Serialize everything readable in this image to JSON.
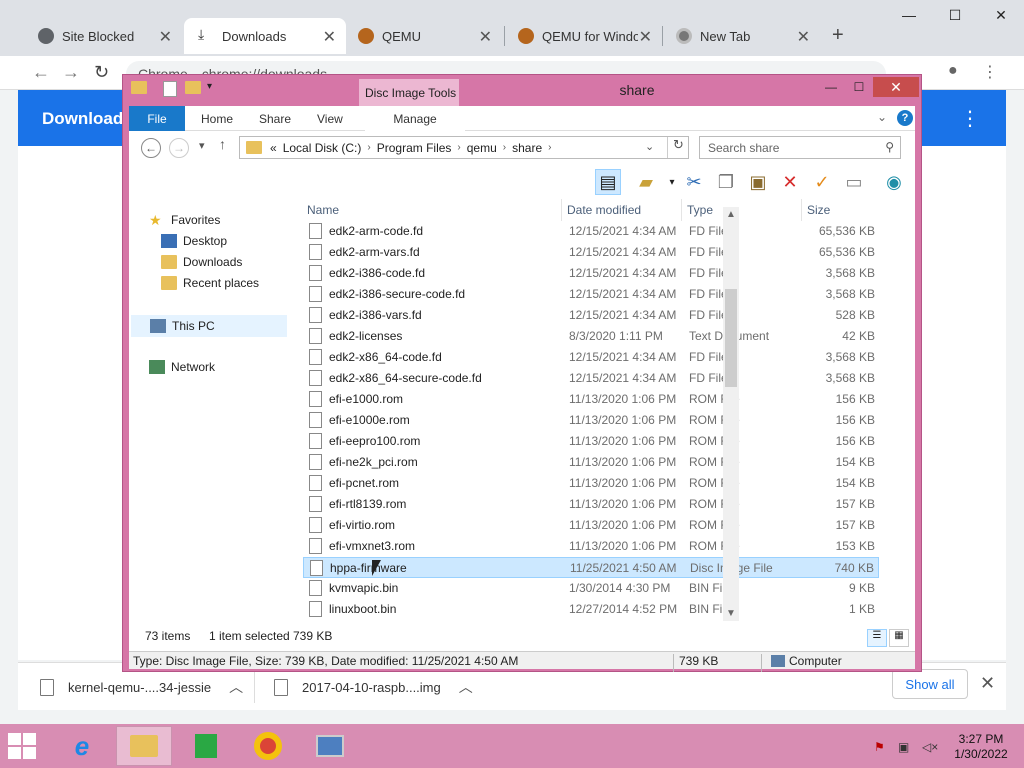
{
  "browser": {
    "tabs": [
      {
        "label": "Site Blocked",
        "icon": "globe-icon"
      },
      {
        "label": "Downloads",
        "icon": "download-icon"
      },
      {
        "label": "QEMU",
        "icon": "qemu-icon"
      },
      {
        "label": "QEMU for Windo",
        "icon": "qemu-icon"
      },
      {
        "label": "New Tab",
        "icon": "chrome-icon"
      }
    ],
    "new_tab": "+",
    "window_controls": {
      "minimize": "—",
      "maximize": "☐",
      "close": "✕"
    },
    "omnibox": {
      "site": "Chrome",
      "url": "chrome://downloads"
    },
    "page_title": "Downloads",
    "download_items": [
      {
        "name": "kernel-qemu-....34-jessie"
      },
      {
        "name": "2017-04-10-raspb....img"
      }
    ],
    "show_all": "Show all"
  },
  "explorer": {
    "title": "share",
    "contextual_tab_group": "Disc Image Tools",
    "ribbon_tabs": [
      "File",
      "Home",
      "Share",
      "View",
      "Manage"
    ],
    "address": {
      "prefix": "«",
      "crumbs": [
        "Local Disk (C:)",
        "Program Files",
        "qemu",
        "share"
      ]
    },
    "search_placeholder": "Search share",
    "nav_pane": {
      "favorites": "Favorites",
      "desktop": "Desktop",
      "downloads": "Downloads",
      "recent": "Recent places",
      "this_pc": "This PC",
      "network": "Network"
    },
    "columns": {
      "name": "Name",
      "date": "Date modified",
      "type": "Type",
      "size": "Size"
    },
    "files": [
      {
        "name": "edk2-arm-code.fd",
        "date": "12/15/2021 4:34 AM",
        "type": "FD File",
        "size": "65,536 KB"
      },
      {
        "name": "edk2-arm-vars.fd",
        "date": "12/15/2021 4:34 AM",
        "type": "FD File",
        "size": "65,536 KB"
      },
      {
        "name": "edk2-i386-code.fd",
        "date": "12/15/2021 4:34 AM",
        "type": "FD File",
        "size": "3,568 KB"
      },
      {
        "name": "edk2-i386-secure-code.fd",
        "date": "12/15/2021 4:34 AM",
        "type": "FD File",
        "size": "3,568 KB"
      },
      {
        "name": "edk2-i386-vars.fd",
        "date": "12/15/2021 4:34 AM",
        "type": "FD File",
        "size": "528 KB"
      },
      {
        "name": "edk2-licenses",
        "date": "8/3/2020 1:11 PM",
        "type": "Text Document",
        "size": "42 KB"
      },
      {
        "name": "edk2-x86_64-code.fd",
        "date": "12/15/2021 4:34 AM",
        "type": "FD File",
        "size": "3,568 KB"
      },
      {
        "name": "edk2-x86_64-secure-code.fd",
        "date": "12/15/2021 4:34 AM",
        "type": "FD File",
        "size": "3,568 KB"
      },
      {
        "name": "efi-e1000.rom",
        "date": "11/13/2020 1:06 PM",
        "type": "ROM File",
        "size": "156 KB"
      },
      {
        "name": "efi-e1000e.rom",
        "date": "11/13/2020 1:06 PM",
        "type": "ROM File",
        "size": "156 KB"
      },
      {
        "name": "efi-eepro100.rom",
        "date": "11/13/2020 1:06 PM",
        "type": "ROM File",
        "size": "156 KB"
      },
      {
        "name": "efi-ne2k_pci.rom",
        "date": "11/13/2020 1:06 PM",
        "type": "ROM File",
        "size": "154 KB"
      },
      {
        "name": "efi-pcnet.rom",
        "date": "11/13/2020 1:06 PM",
        "type": "ROM File",
        "size": "154 KB"
      },
      {
        "name": "efi-rtl8139.rom",
        "date": "11/13/2020 1:06 PM",
        "type": "ROM File",
        "size": "157 KB"
      },
      {
        "name": "efi-virtio.rom",
        "date": "11/13/2020 1:06 PM",
        "type": "ROM File",
        "size": "157 KB"
      },
      {
        "name": "efi-vmxnet3.rom",
        "date": "11/13/2020 1:06 PM",
        "type": "ROM File",
        "size": "153 KB"
      },
      {
        "name": "hppa-firmware",
        "date": "11/25/2021 4:50 AM",
        "type": "Disc Image File",
        "size": "740 KB",
        "selected": true
      },
      {
        "name": "kvmvapic.bin",
        "date": "1/30/2014 4:30 PM",
        "type": "BIN File",
        "size": "9 KB"
      },
      {
        "name": "linuxboot.bin",
        "date": "12/27/2014 4:52 PM",
        "type": "BIN File",
        "size": "1 KB"
      }
    ],
    "status": {
      "count": "73 items",
      "selected": "1 item selected",
      "selected_size": "739 KB"
    },
    "details": {
      "summary": "Type: Disc Image File, Size: 739 KB, Date modified: 11/25/2021 4:50 AM",
      "size": "739 KB",
      "location": "Computer"
    }
  },
  "taskbar": {
    "time": "3:27 PM",
    "date": "1/30/2022"
  },
  "colors": {
    "accent_blue": "#1a73e8",
    "window_frame": "#d676a7",
    "taskbar": "#d88db3",
    "selection": "#cce8ff"
  }
}
